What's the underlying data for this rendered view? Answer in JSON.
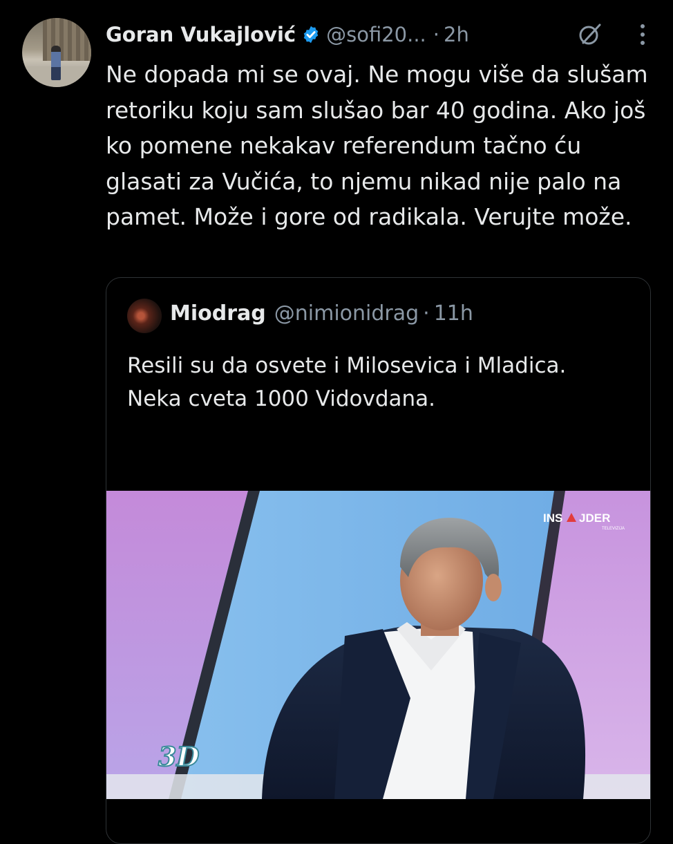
{
  "tweet": {
    "author_name": "Goran Vukajlović",
    "handle": "@sofi20...",
    "separator": "·",
    "time": "2h",
    "text": "Ne dopada mi se ovaj. Ne mogu više da slušam retoriku koju sam slušao bar 40 godina. Ako još ko pomene nekakav referendum tačno ću glasati za Vučića, to njemu nikad nije palo na pamet. Može i gore od radikala. Verujte može."
  },
  "quoted_tweet": {
    "author_name": "Miodrag",
    "handle": "@nimionidrag",
    "separator": "·",
    "time": "11h",
    "text_line1": "Resili su da osvete i Milosevica i Mladica.",
    "text_line2": "Neka cveta 1000 Vidovdana."
  },
  "media": {
    "channel_logo_a": "INS",
    "channel_logo_b": "JDER",
    "channel_sub": "TELEVIZIJA",
    "show_badge": "3D"
  },
  "colors": {
    "background": "#000000",
    "text_primary": "#e7e9ea",
    "text_secondary": "#8b98a5",
    "verified_blue": "#1d9bf0",
    "border": "#2f3336"
  },
  "icons": [
    "verified-badge-icon",
    "grok-icon",
    "more-options-icon"
  ]
}
